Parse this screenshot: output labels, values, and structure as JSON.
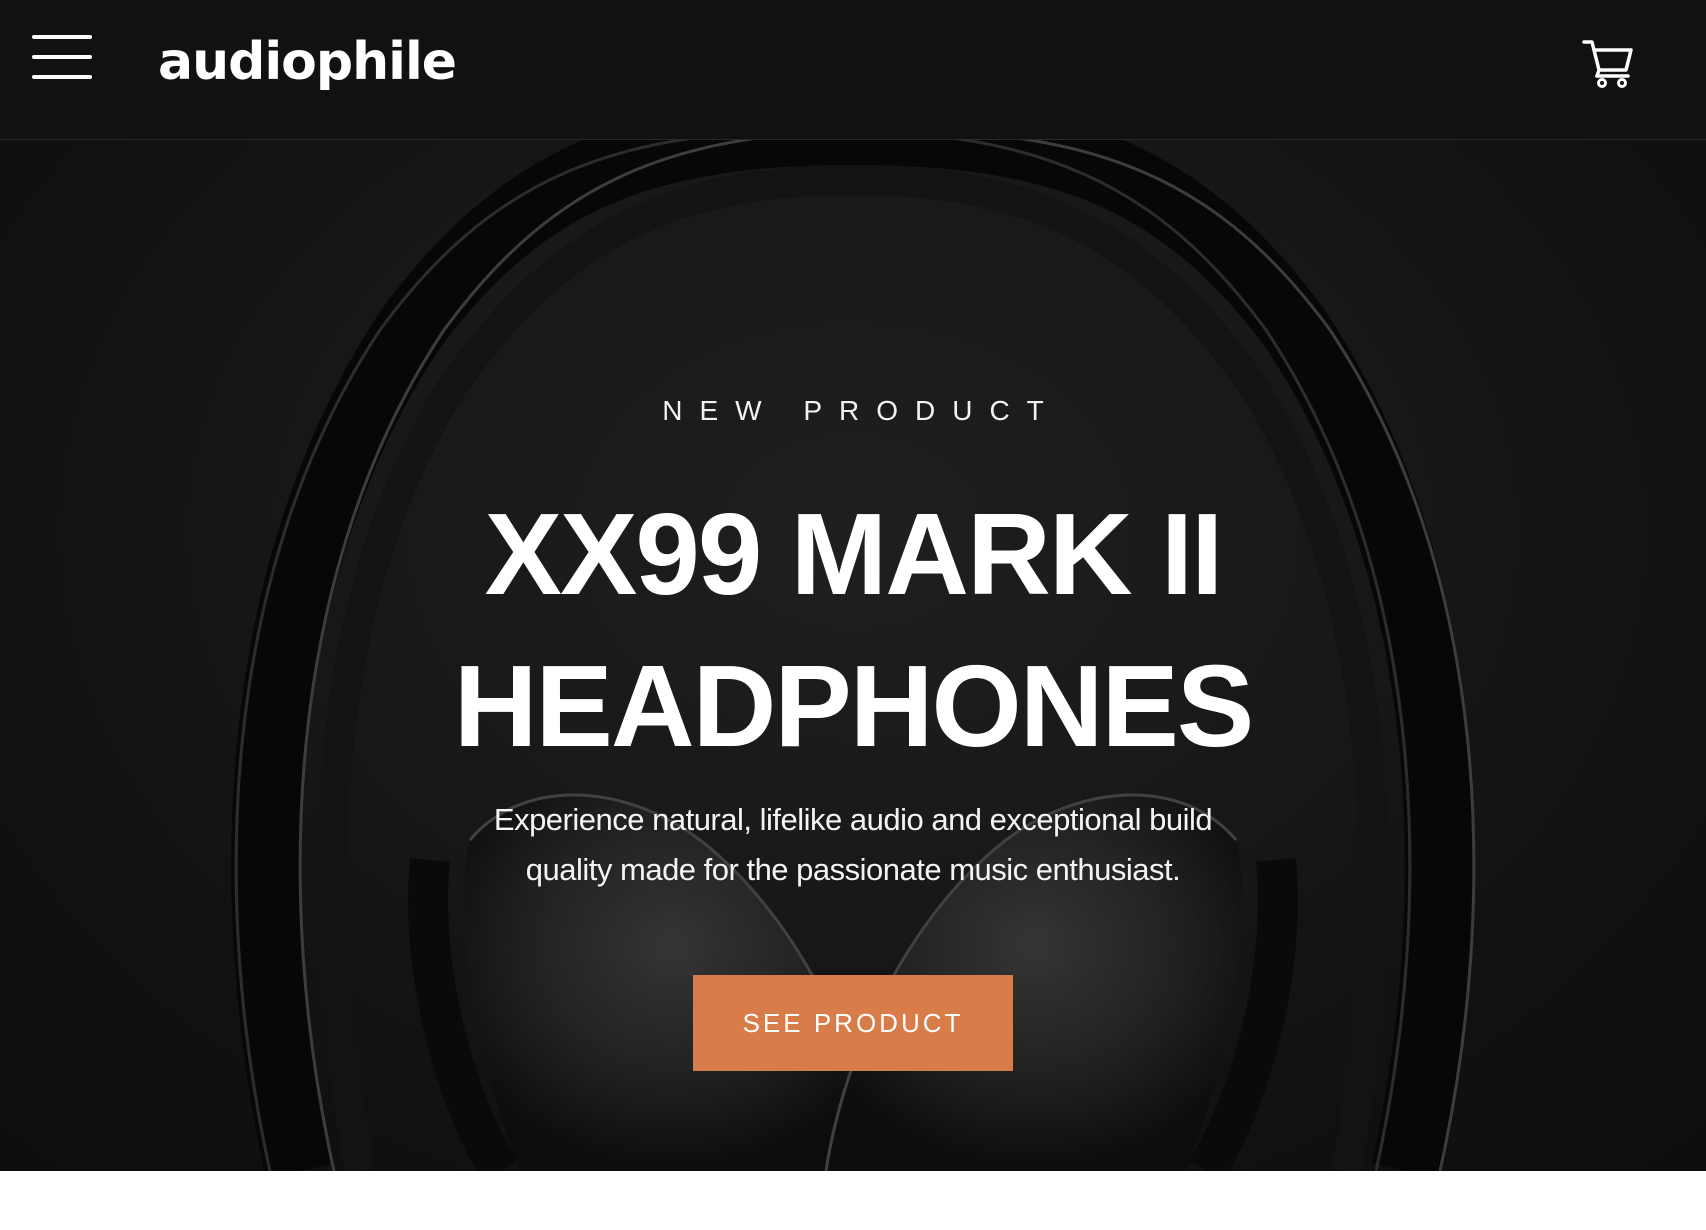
{
  "header": {
    "logo_text": "audiophile",
    "menu_icon": "hamburger-menu-icon",
    "cart_icon": "shopping-cart-icon"
  },
  "hero": {
    "eyebrow": "NEW PRODUCT",
    "title_line1": "XX99 MARK II",
    "title_line2": "HEADPHONES",
    "description": "Experience natural, lifelike audio and exceptional build quality made for the passionate music enthusiast.",
    "cta_label": "SEE PRODUCT",
    "background_image": "headphones-photo"
  },
  "colors": {
    "header_bg": "#111111",
    "hero_bg": "#1e1e1e",
    "accent": "#d87d4a",
    "text": "#ffffff",
    "page_bg": "#ffffff"
  }
}
